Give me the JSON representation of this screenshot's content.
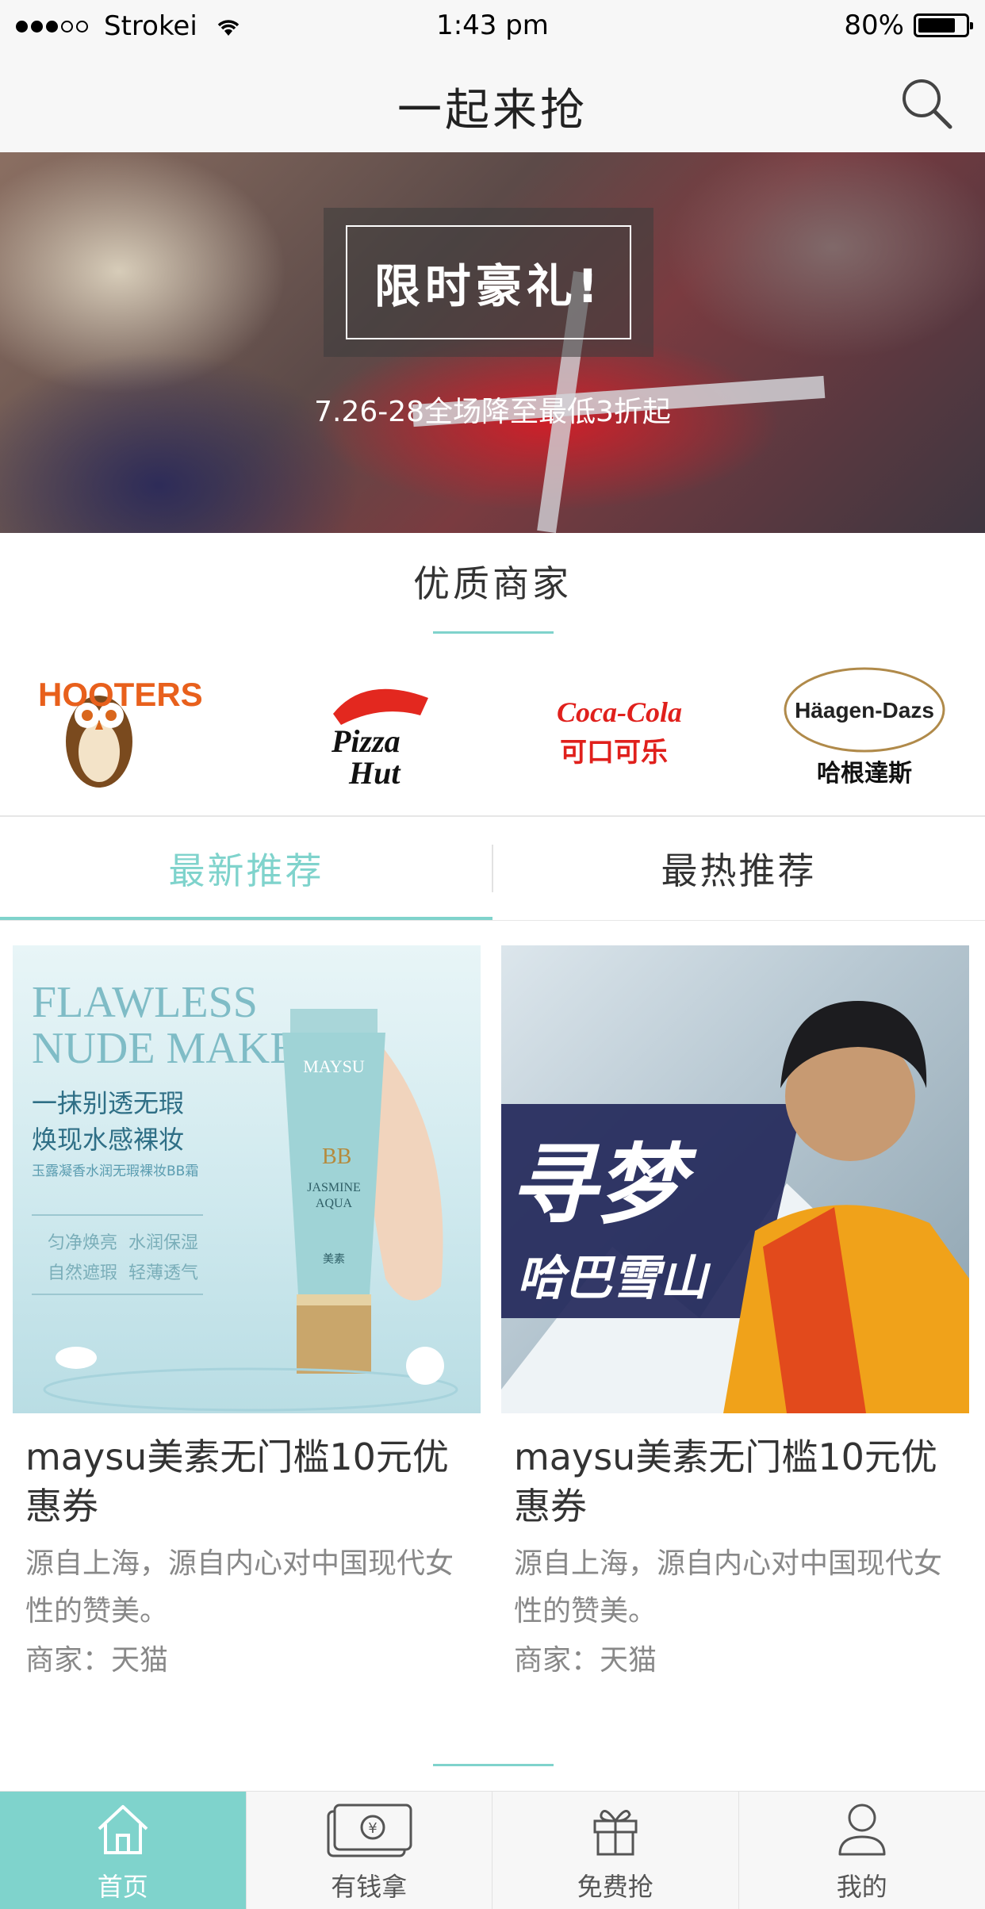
{
  "status_bar": {
    "carrier": "Strokei",
    "time": "1:43 pm",
    "battery_percent": "80%",
    "battery_level": 0.8,
    "signal_bars": 3
  },
  "nav": {
    "title": "一起来抢",
    "search_icon": "search-icon"
  },
  "banner": {
    "headline": "限时豪礼!",
    "subtitle": "7.26-28全场降至最低3折起"
  },
  "merchants": {
    "title": "优质商家",
    "logos": [
      {
        "name": "Hooters",
        "text": "HOOTERS"
      },
      {
        "name": "Pizza Hut",
        "text": "Pizza Hut"
      },
      {
        "name": "Coca-Cola",
        "text": "Coca-Cola",
        "text_cn": "可口可乐"
      },
      {
        "name": "Häagen-Dazs",
        "text": "Häagen-Dazs",
        "text_cn": "哈根達斯"
      }
    ]
  },
  "tabs": [
    {
      "label": "最新推荐",
      "active": true
    },
    {
      "label": "最热推荐",
      "active": false
    }
  ],
  "cards": [
    {
      "title": "maysu美素无门槛10元优惠券",
      "description": "源自上海，源自内心对中国现代女性的赞美。",
      "merchant": "商家：天猫",
      "image_text": {
        "line1": "FLAWLESS",
        "line2": "NUDE MAKEUP",
        "cn1": "一抹别透无瑕",
        "cn2": "焕现水感裸妆",
        "cn3": "玉露凝香水润无瑕裸妆BB霜",
        "f1": "匀净焕亮",
        "f2": "水润保湿",
        "f3": "自然遮瑕",
        "f4": "轻薄透气",
        "tube_brand": "MAYSU",
        "tube_bb": "BB",
        "tube_line1": "JASMINE",
        "tube_line2": "AQUA",
        "tube_cn": "美素"
      }
    },
    {
      "title": "maysu美素无门槛10元优惠券",
      "description": "源自上海，源自内心对中国现代女性的赞美。",
      "merchant": "商家：天猫",
      "image_text": {
        "big": "寻梦",
        "sub": "哈巴雪山"
      }
    }
  ],
  "tab_bar": [
    {
      "label": "首页",
      "icon": "home-icon",
      "active": true
    },
    {
      "label": "有钱拿",
      "icon": "money-icon",
      "active": false
    },
    {
      "label": "免费抢",
      "icon": "gift-icon",
      "active": false
    },
    {
      "label": "我的",
      "icon": "user-icon",
      "active": false
    }
  ],
  "colors": {
    "accent": "#7fd3cc",
    "bar_bg": "#f7f7f7"
  }
}
